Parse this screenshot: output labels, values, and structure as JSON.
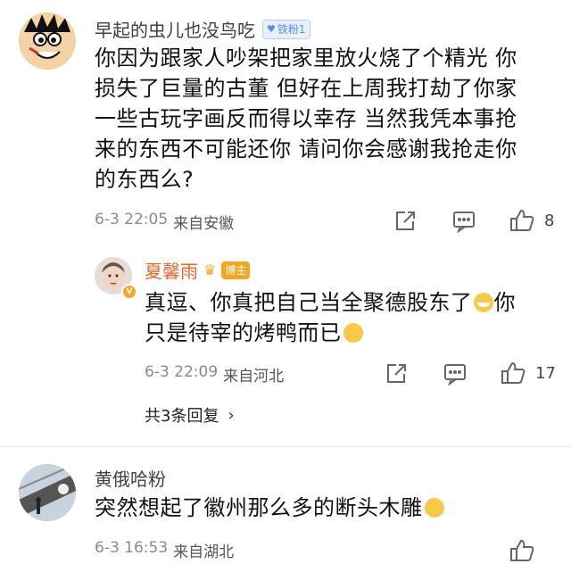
{
  "comments": [
    {
      "username": "早起的虫儿也没鸟吃",
      "badge": "铁粉1",
      "text_lines": [
        "你因为跟家人吵架把家里放火烧了个精光 你",
        "损失了巨量的古董 但好在上周我打劫了你家",
        "一些古玩字画反而得以幸存 当然我凭本事抢",
        "来的东西不可能还你  请问你会感谢我抢走你",
        "的东西么?"
      ],
      "time": "6-3 22:05",
      "location": "来自安徽",
      "likes": "8"
    },
    {
      "username": "黄俄哈粉",
      "text": "突然想起了徽州那么多的断头木雕",
      "time": "6-3 16:53",
      "location": "来自湖北"
    }
  ],
  "reply": {
    "username": "夏馨雨",
    "badge": "博主",
    "text_line1": "真逗、你真把自己当全聚德股东了",
    "text_line1_end": "你",
    "text_line2": "只是待宰的烤鸭而已",
    "time": "6-3 22:09",
    "location": "来自河北",
    "likes": "17"
  },
  "more_replies_label": "共3条回复",
  "colors": {
    "badge_fan": "#5b8def",
    "badge_owner": "#f5a623",
    "verified": "#f5a623"
  }
}
